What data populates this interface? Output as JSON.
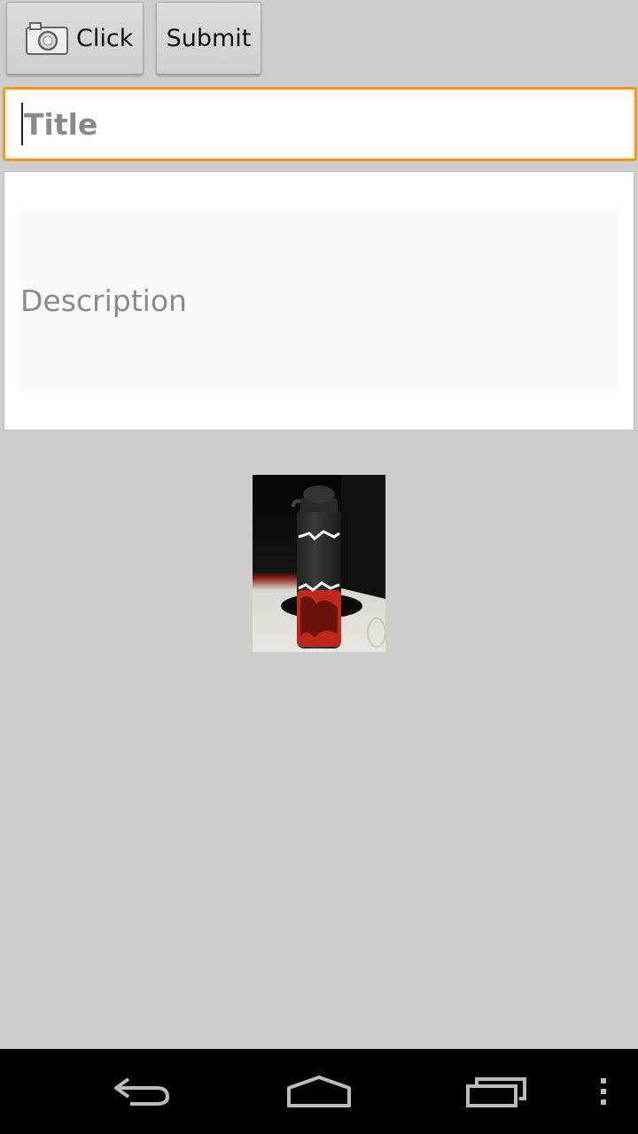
{
  "toolbar": {
    "click_label": "Click",
    "submit_label": "Submit"
  },
  "form": {
    "title_placeholder": "Title",
    "description_placeholder": "Description"
  },
  "colors": {
    "focus_accent": "#f39a1e",
    "background": "#cdcdcd"
  },
  "icons": {
    "camera": "camera-icon",
    "back": "back-icon",
    "home": "home-icon",
    "recent": "recent-apps-icon",
    "menu": "overflow-menu-icon"
  }
}
